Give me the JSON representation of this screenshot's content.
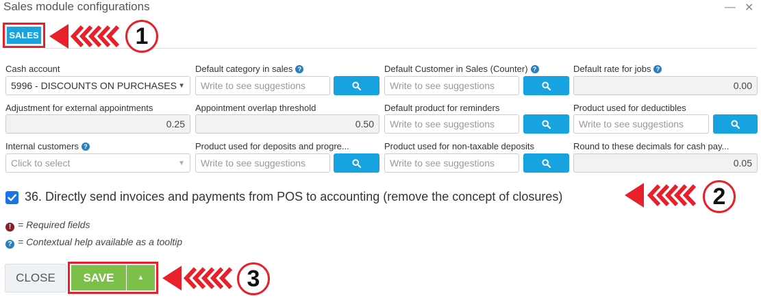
{
  "window": {
    "title": "Sales module configurations",
    "minimize": "—",
    "close": "✕"
  },
  "tabs": {
    "active_label": "SALES"
  },
  "row1": {
    "cash_account": {
      "label": "Cash account",
      "value": "5996 - DISCOUNTS ON PURCHASES"
    },
    "default_category": {
      "label": "Default category in sales",
      "placeholder": "Write to see suggestions"
    },
    "default_customer": {
      "label": "Default Customer in Sales (Counter)",
      "placeholder": "Write to see suggestions"
    },
    "default_rate": {
      "label": "Default rate for jobs",
      "value": "0.00"
    }
  },
  "row2": {
    "adjustment": {
      "label": "Adjustment for external appointments",
      "value": "0.25"
    },
    "overlap": {
      "label": "Appointment overlap threshold",
      "value": "0.50"
    },
    "reminder_product": {
      "label": "Default product for reminders",
      "placeholder": "Write to see suggestions"
    },
    "deductibles": {
      "label": "Product used for deductibles",
      "placeholder": "Write to see suggestions"
    }
  },
  "row3": {
    "internal_customers": {
      "label": "Internal customers",
      "placeholder": "Click to select"
    },
    "deposits_progress": {
      "label": "Product used for deposits and progre...",
      "placeholder": "Write to see suggestions"
    },
    "non_taxable": {
      "label": "Product used for non-taxable deposits",
      "placeholder": "Write to see suggestions"
    },
    "round_decimals": {
      "label": "Round to these decimals for cash pay...",
      "value": "0.05"
    }
  },
  "option_36": {
    "label": "36. Directly send invoices and payments from POS to accounting (remove the concept of closures)",
    "checked": true
  },
  "legend": {
    "required": "= Required fields",
    "help": "= Contextual help available as a tooltip",
    "required_glyph": "!",
    "help_glyph": "?"
  },
  "buttons": {
    "close": "CLOSE",
    "save": "SAVE"
  },
  "annotations": {
    "step1": "1",
    "step2": "2",
    "step3": "3"
  },
  "colors": {
    "accent_blue": "#17a2e0",
    "save_green": "#7cc04a",
    "annotation_red": "#e8202a"
  }
}
